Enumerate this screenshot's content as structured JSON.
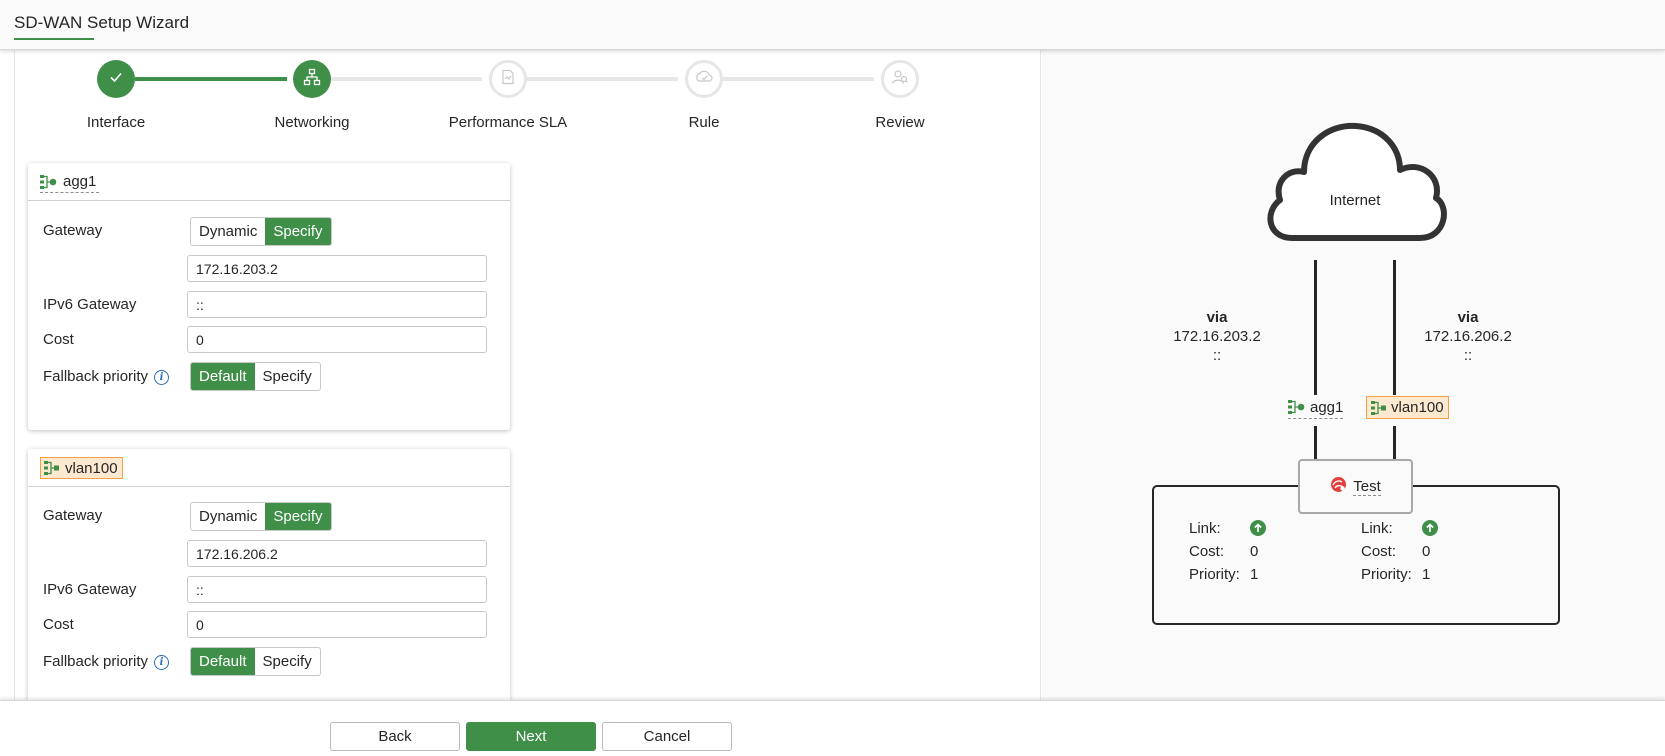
{
  "header": {
    "title": "SD-WAN Setup Wizard"
  },
  "stepper": {
    "steps": [
      {
        "label": "Interface",
        "state": "done",
        "icon": "check-icon"
      },
      {
        "label": "Networking",
        "state": "current",
        "icon": "network-icon"
      },
      {
        "label": "Performance SLA",
        "state": "todo",
        "icon": "sla-icon"
      },
      {
        "label": "Rule",
        "state": "todo",
        "icon": "rule-icon"
      },
      {
        "label": "Review",
        "state": "todo",
        "icon": "review-icon"
      }
    ]
  },
  "interfaces": [
    {
      "name": "agg1",
      "tag_style": "plain",
      "gateway_label": "Gateway",
      "gateway_options": [
        "Dynamic",
        "Specify"
      ],
      "gateway_selected": "Specify",
      "gateway_value": "172.16.203.2",
      "ipv6_label": "IPv6 Gateway",
      "ipv6_value": "::",
      "cost_label": "Cost",
      "cost_value": "0",
      "fallback_label": "Fallback priority",
      "fallback_options": [
        "Default",
        "Specify"
      ],
      "fallback_selected": "Default"
    },
    {
      "name": "vlan100",
      "tag_style": "orange",
      "gateway_label": "Gateway",
      "gateway_options": [
        "Dynamic",
        "Specify"
      ],
      "gateway_selected": "Specify",
      "gateway_value": "172.16.206.2",
      "ipv6_label": "IPv6 Gateway",
      "ipv6_value": "::",
      "cost_label": "Cost",
      "cost_value": "0",
      "fallback_label": "Fallback priority",
      "fallback_options": [
        "Default",
        "Specify"
      ],
      "fallback_selected": "Default"
    }
  ],
  "diagram": {
    "cloud_label": "Internet",
    "left_link": {
      "via": "via",
      "ipv4": "172.16.203.2",
      "ipv6": "::",
      "interface": "agg1"
    },
    "right_link": {
      "via": "via",
      "ipv4": "172.16.206.2",
      "ipv6": "::",
      "interface": "vlan100"
    },
    "zone_name": "Test",
    "members": [
      {
        "link_label": "Link:",
        "cost_label": "Cost:",
        "cost": "0",
        "priority_label": "Priority:",
        "priority": "1",
        "link_status": "up"
      },
      {
        "link_label": "Link:",
        "cost_label": "Cost:",
        "cost": "0",
        "priority_label": "Priority:",
        "priority": "1",
        "link_status": "up"
      }
    ]
  },
  "footer": {
    "back": "Back",
    "next": "Next",
    "cancel": "Cancel"
  },
  "colors": {
    "accent": "#3f8f49",
    "orange_tag_bg": "#fde9d0",
    "orange_tag_border": "#f0a14a",
    "info_blue": "#2a6db5"
  }
}
